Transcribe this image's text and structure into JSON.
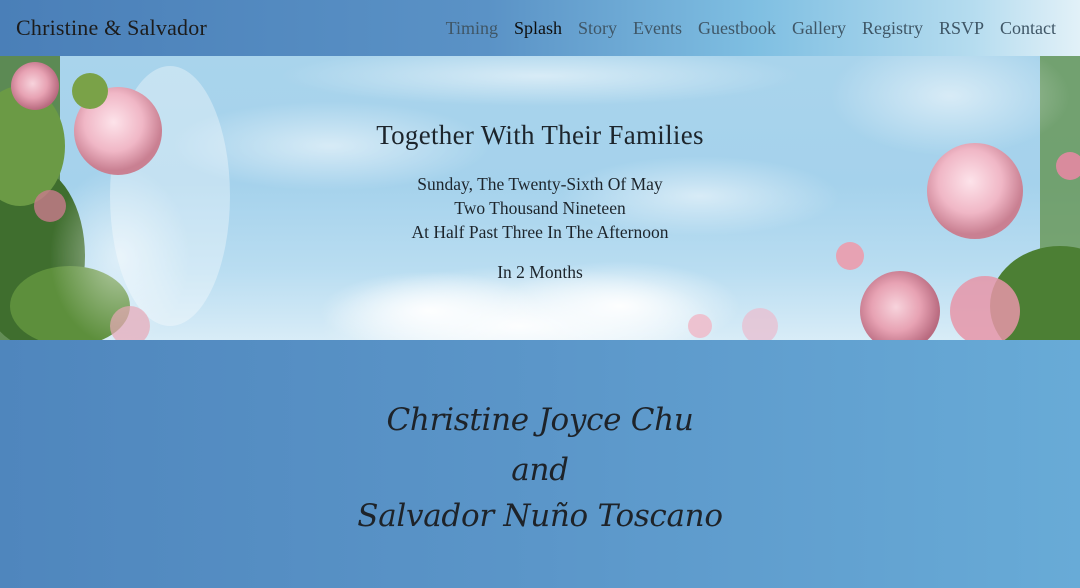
{
  "navbar": {
    "brand": "Christine & Salvador",
    "items": [
      {
        "label": "Timing",
        "active": false
      },
      {
        "label": "Splash",
        "active": true
      },
      {
        "label": "Story",
        "active": false
      },
      {
        "label": "Events",
        "active": false
      },
      {
        "label": "Guestbook",
        "active": false
      },
      {
        "label": "Gallery",
        "active": false
      },
      {
        "label": "Registry",
        "active": false
      },
      {
        "label": "RSVP",
        "active": false
      },
      {
        "label": "Contact",
        "active": false
      }
    ]
  },
  "hero": {
    "title": "Together With Their Families",
    "date_line": "Sunday, The Twenty-Sixth Of May",
    "year_line": "Two Thousand Nineteen",
    "time_line": "At Half Past Three In The Afternoon",
    "countdown": "In 2 Months"
  },
  "names": {
    "bride": "Christine Joyce Chu",
    "conjunction": "and",
    "groom": "Salvador Nuño Toscano"
  },
  "colors": {
    "nav_gradient_start": "#4a7fb8",
    "nav_gradient_end": "#e2f1f8",
    "sky": "#a9d4ec",
    "names_bg": "#5b93c4",
    "rose": "#e9a9b6"
  }
}
